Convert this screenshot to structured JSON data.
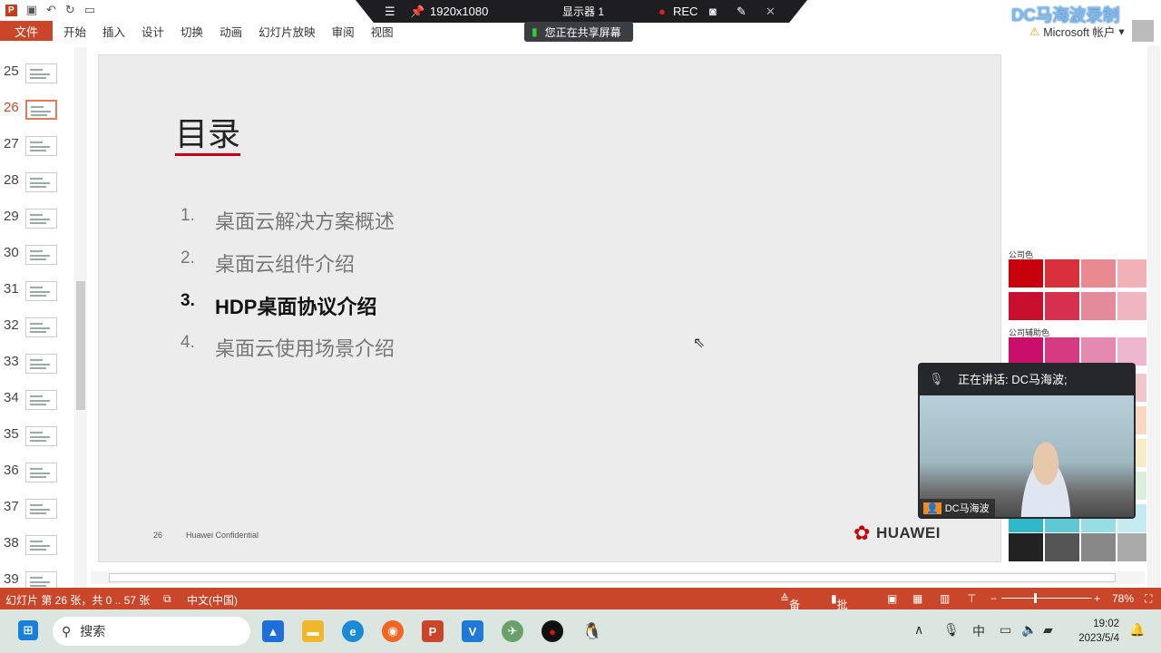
{
  "qat": {
    "app_logo": "P",
    "icons": [
      "save-icon",
      "undo-icon",
      "redo-icon",
      "presenter-icon"
    ]
  },
  "ribbon": {
    "file": "文件",
    "tabs": [
      "开始",
      "插入",
      "设计",
      "切换",
      "动画",
      "幻灯片放映",
      "审阅",
      "视图"
    ]
  },
  "sharebar": {
    "resolution": "1920x1080",
    "display": "显示器 1",
    "rec": "REC",
    "tip": "您正在共享屏幕"
  },
  "watermark": "DC马海波录制",
  "account": {
    "label": "Microsoft 帐户"
  },
  "thumbnails": {
    "numbers": [
      "25",
      "26",
      "27",
      "28",
      "29",
      "30",
      "31",
      "32",
      "33",
      "34",
      "35",
      "36",
      "37",
      "38",
      "39"
    ],
    "selected": "26"
  },
  "slide": {
    "title": "目录",
    "items": [
      {
        "n": "1.",
        "text": "桌面云解决方案概述"
      },
      {
        "n": "2.",
        "text": "桌面云组件介绍"
      },
      {
        "n": "3.",
        "text": "HDP桌面协议介绍",
        "active": true
      },
      {
        "n": "4.",
        "text": "桌面云使用场景介绍"
      }
    ],
    "page": "26",
    "confidential": "Huawei Confidential",
    "brand": "HUAWEI",
    "brand_color": "#c7000b"
  },
  "palette": {
    "label1": "公司色",
    "label2": "公司辅助色"
  },
  "speaker": {
    "status": "正在讲话:  DC马海波;",
    "name": "DC马海波"
  },
  "statusbar": {
    "slide_info": "幻灯片 第 26 张，共 0 .. 57 张",
    "language": "中文(中国)",
    "notes": "备注",
    "comments": "批注",
    "zoom": "78%"
  },
  "taskbar": {
    "search": "搜索",
    "time": "19:02",
    "date": "2023/5/4",
    "ime": "中"
  },
  "colors": {
    "accent": "#c9462a",
    "taskbar": "#dbe6e0"
  }
}
